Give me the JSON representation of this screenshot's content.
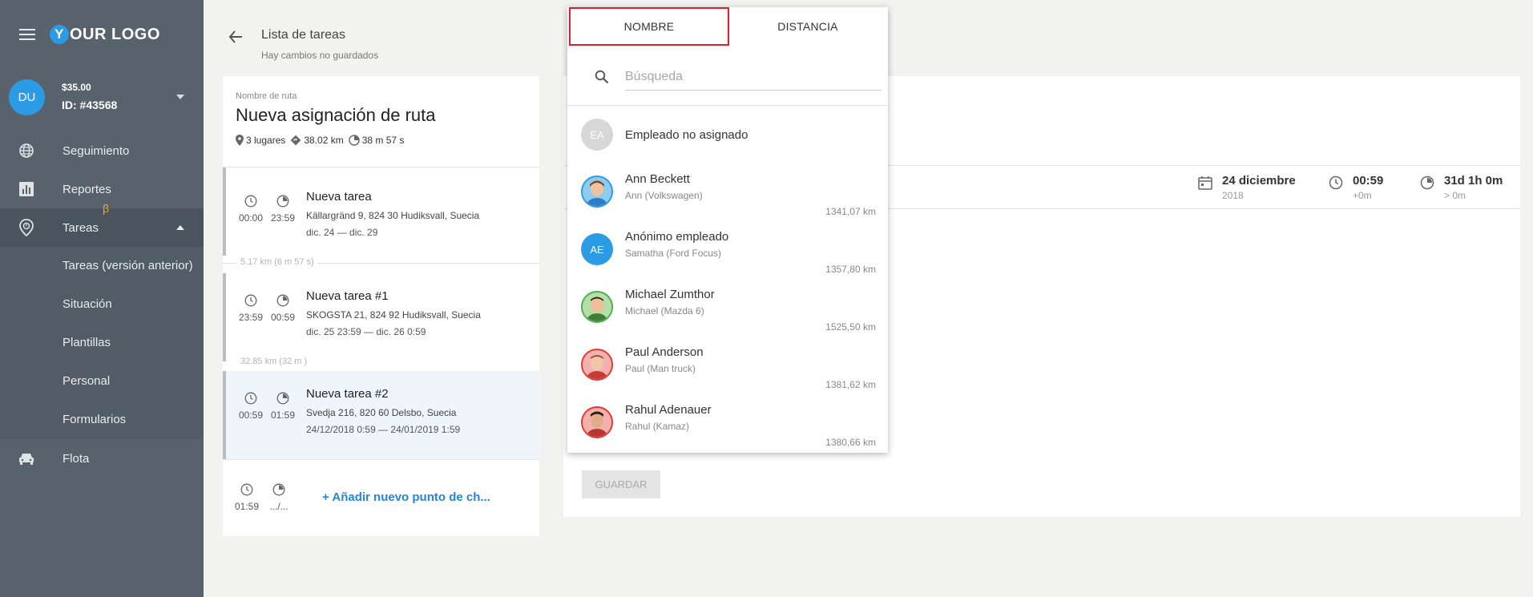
{
  "sidebar": {
    "logo_y": "Y",
    "logo_rest": "OUR LOGO",
    "account": {
      "initials": "DU",
      "balance": "$35.00",
      "id": "ID: #43568"
    },
    "nav": [
      {
        "label": "Seguimiento",
        "icon": "globe-icon"
      },
      {
        "label": "Reportes",
        "icon": "bar-chart-icon"
      },
      {
        "label": "Tareas",
        "icon": "location-clock-icon",
        "badge": "β"
      },
      {
        "label": "Flota",
        "icon": "car-icon"
      }
    ],
    "submenu": [
      "Tareas (versión anterior)",
      "Situación",
      "Plantillas",
      "Personal",
      "Formularios"
    ]
  },
  "header": {
    "title": "Lista de tareas",
    "subtitle": "Hay cambios no guardados"
  },
  "route": {
    "label": "Nombre de ruta",
    "name": "Nueva asignación de ruta",
    "places": "3 lugares",
    "distance": "38.02 km",
    "duration": "38 m 57 s"
  },
  "tasks": [
    {
      "name": "Nueva tarea",
      "address": "Källargränd 9, 824 30 Hudiksvall, Suecia",
      "dates": "dic. 24 — dic. 29",
      "start": "00:00",
      "end": "23:59"
    },
    {
      "name": "Nueva tarea #1",
      "address": "SKOGSTA 21, 824 92 Hudiksvall, Suecia",
      "dates": "dic. 25 23:59 — dic. 26 0:59",
      "start": "23:59",
      "end": "00:59"
    },
    {
      "name": "Nueva tarea #2",
      "address": "Svedja 216, 820 60 Delsbo, Suecia",
      "dates": "24/12/2018 0:59 — 24/01/2019 1:59",
      "start": "00:59",
      "end": "01:59"
    }
  ],
  "segments": [
    "5.17 km (6 m 57 s)",
    "32.85 km (32 m )"
  ],
  "add_point": {
    "start": "01:59",
    "end": ".../...",
    "label": "+ Añadir nuevo punto de ch..."
  },
  "right": {
    "date": "24 diciembre",
    "date_sub": "2018",
    "time": "00:59",
    "time_sub": "+0m",
    "duration": "31d 1h 0m",
    "duration_sub": "> 0m",
    "save": "GUARDAR"
  },
  "popup": {
    "tabs": [
      "NOMBRE",
      "DISTANCIA"
    ],
    "search_placeholder": "Búsqueda",
    "unassigned": {
      "initials": "EA",
      "label": "Empleado no asignado"
    },
    "employees": [
      {
        "name": "Ann Beckett",
        "vehicle": "Ann (Volkswagen)",
        "distance": "1341,07 km",
        "avatar": "photo",
        "ring": "#2b9be6"
      },
      {
        "name": "Anónimo empleado",
        "vehicle": "Samatha (Ford Focus)",
        "distance": "1357,80 km",
        "avatar": "AE",
        "ring": "#2b9be6"
      },
      {
        "name": "Michael Zumthor",
        "vehicle": "Michael (Mazda 6)",
        "distance": "1525,50 km",
        "avatar": "photo",
        "ring": "#4caf50"
      },
      {
        "name": "Paul Anderson",
        "vehicle": "Paul (Man truck)",
        "distance": "1381,62 km",
        "avatar": "photo",
        "ring": "#e53935"
      },
      {
        "name": "Rahul Adenauer",
        "vehicle": "Rahul (Kamaz)",
        "distance": "1380,66 km",
        "avatar": "photo",
        "ring": "#e53935"
      }
    ]
  },
  "colors": {
    "sidebar": "#57626d",
    "accent": "#2b9be6",
    "beta": "#f5a623",
    "highlight": "#e01f2a"
  }
}
